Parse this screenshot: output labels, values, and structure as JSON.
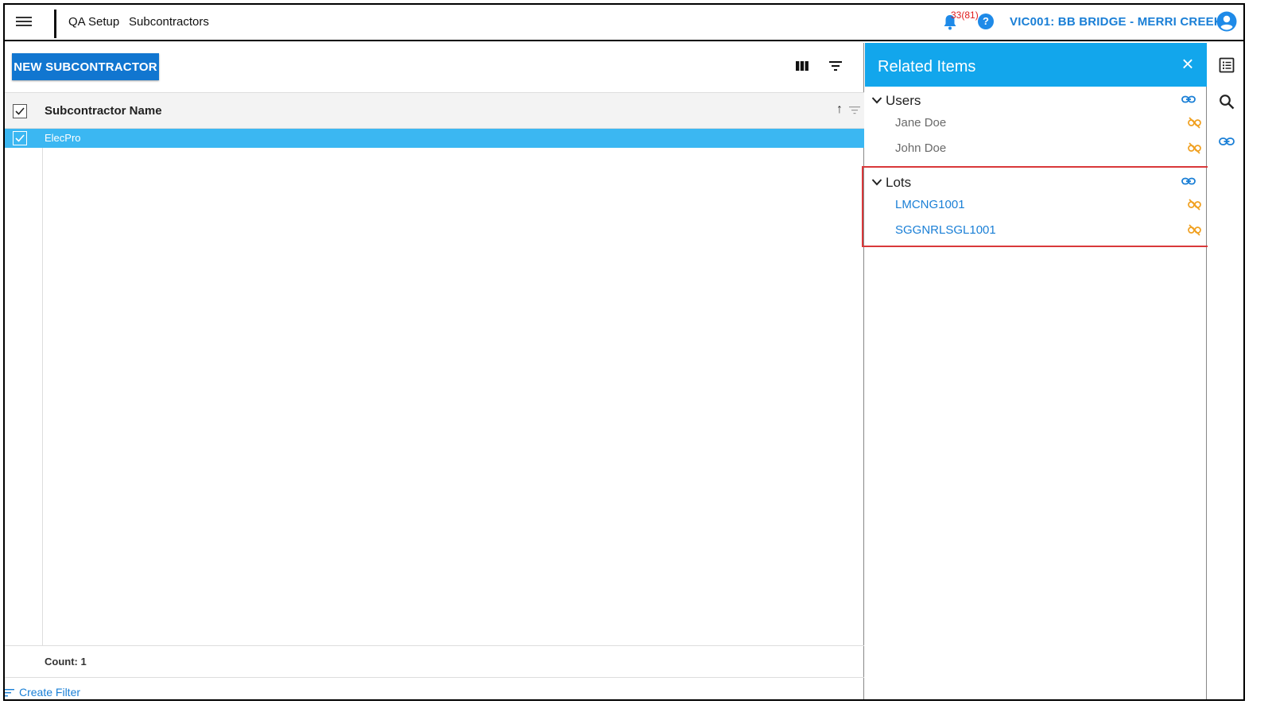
{
  "topbar": {
    "breadcrumb": [
      "QA Setup",
      "Subcontractors"
    ],
    "notification_count": "33(81)",
    "help_label": "?",
    "project": "VIC001: BB BRIDGE - MERRI CREEK",
    "notification_color": "#e01b1b",
    "accent_color": "#1a7fd6"
  },
  "toolbar": {
    "new_button_label": "NEW SUBCONTRACTOR",
    "icons": [
      "columns-icon",
      "filter-icon"
    ]
  },
  "grid": {
    "columns": [
      "Subcontractor Name"
    ],
    "rows": [
      {
        "name": "ElecPro",
        "selected": true
      }
    ],
    "selected_row_color": "#3bb7f2",
    "count_label": "Count: 1"
  },
  "footer": {
    "create_filter_label": "Create Filter"
  },
  "related_panel": {
    "title": "Related Items",
    "header_color": "#12a6ec",
    "close_label": "×",
    "groups": [
      {
        "title": "Users",
        "items": [
          "Jane Doe",
          "John Doe"
        ]
      },
      {
        "title": "Lots",
        "items": [
          "LMCNG1001",
          "SGGNRLSGL1001"
        ]
      }
    ],
    "unlink_color": "#f0a020",
    "highlight_color": "#d9383a"
  },
  "rail": {
    "icons": [
      "list-icon",
      "search-icon",
      "link-icon"
    ]
  }
}
